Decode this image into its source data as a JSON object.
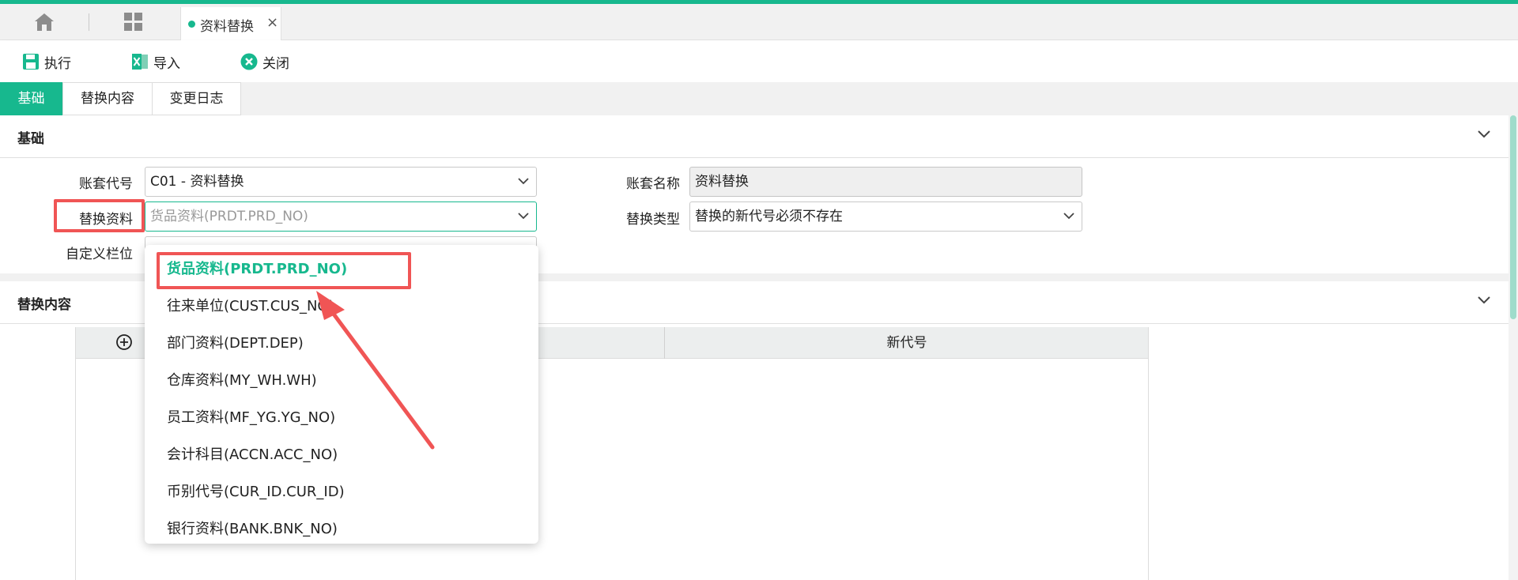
{
  "tabstrip": {
    "active_tab_label": "资料替换",
    "close_glyph": "×",
    "icons": [
      "home-icon",
      "grid-icon"
    ]
  },
  "toolbar": {
    "execute_label": "执行",
    "import_label": "导入",
    "close_label": "关闭"
  },
  "subtabs": [
    "基础",
    "替换内容",
    "变更日志"
  ],
  "sections": {
    "basic_title": "基础",
    "replace_title": "替换内容"
  },
  "form": {
    "account_code_label": "账套代号",
    "account_code_value": "C01 - 资料替换",
    "account_name_label": "账套名称",
    "account_name_value": "资料替换",
    "replace_data_label": "替换资料",
    "replace_data_placeholder": "货品资料(PRDT.PRD_NO)",
    "replace_type_label": "替换类型",
    "replace_type_value": "替换的新代号必须不存在",
    "custom_field_label": "自定义栏位"
  },
  "grid": {
    "col_new_code": "新代号"
  },
  "dropdown": {
    "options": [
      "货品资料(PRDT.PRD_NO)",
      "往来单位(CUST.CUS_NO)",
      "部门资料(DEPT.DEP)",
      "仓库资料(MY_WH.WH)",
      "员工资料(MF_YG.YG_NO)",
      "会计科目(ACCN.ACC_NO)",
      "币别代号(CUR_ID.CUR_ID)",
      "银行资料(BANK.BNK_NO)"
    ],
    "selected_index": 0
  },
  "colors": {
    "accent": "#17b88e",
    "annotation": "#f05555"
  }
}
